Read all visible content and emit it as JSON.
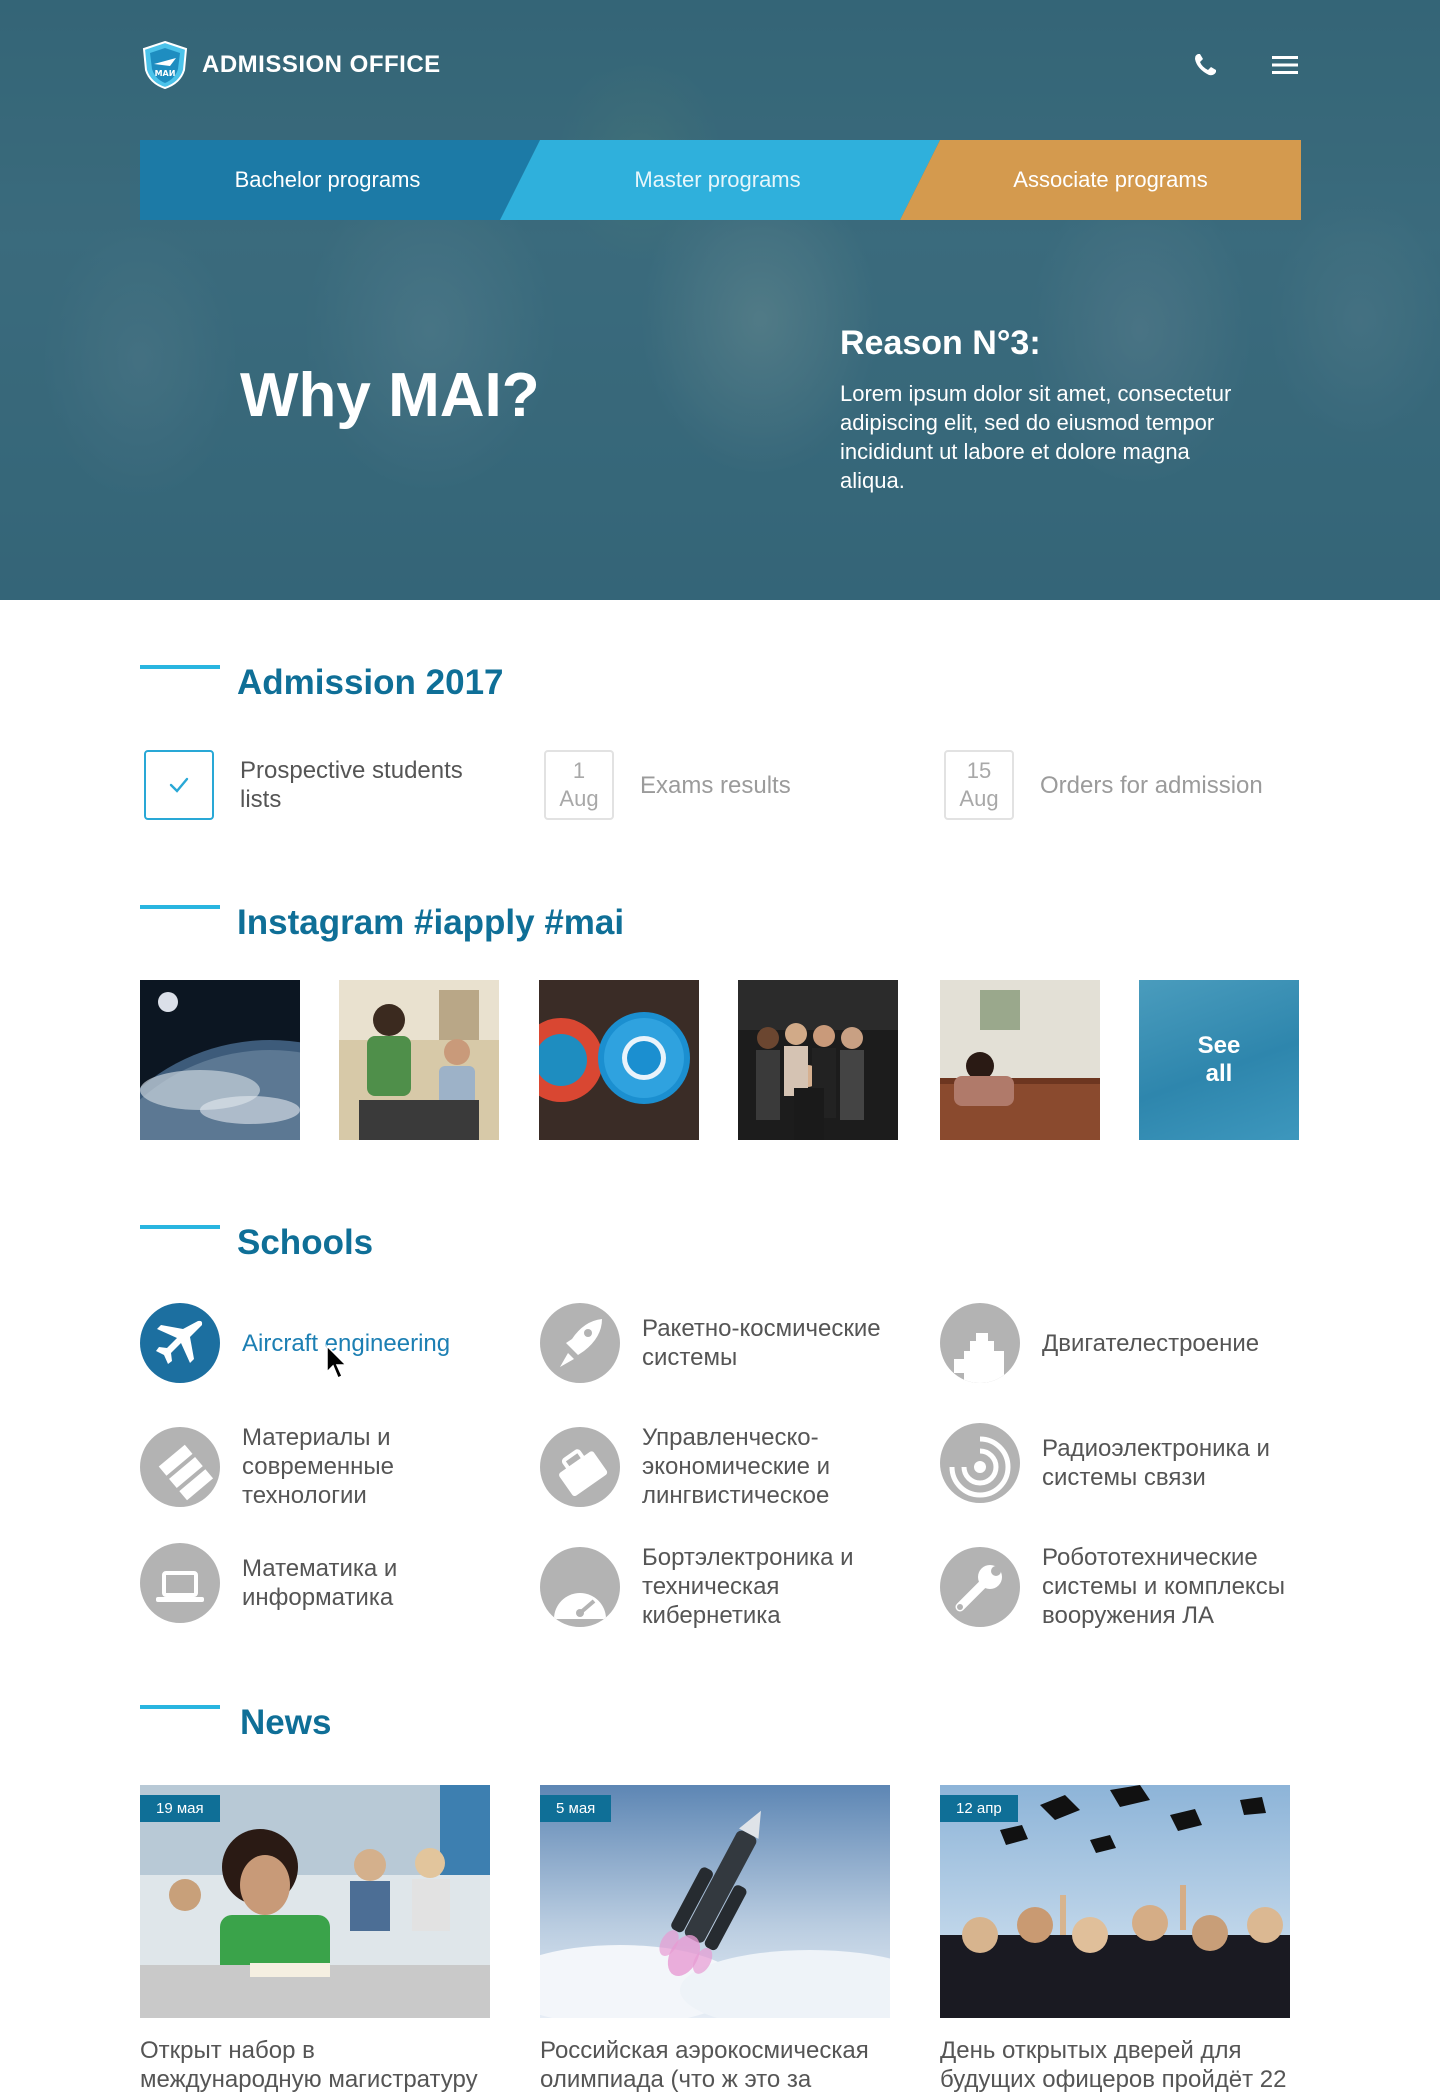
{
  "header": {
    "logo_text": "ADMISSION OFFICE",
    "logo_mark": "МАИ",
    "icons": [
      "phone-icon",
      "menu-icon"
    ]
  },
  "program_tabs": [
    {
      "label": "Bachelor programs",
      "color": "#1c7aa6"
    },
    {
      "label": "Master programs",
      "color": "#2fb0dc"
    },
    {
      "label": "Associate programs",
      "color": "#d49a4e"
    }
  ],
  "hero": {
    "headline": "Why MAI?",
    "reason_title": "Reason N°3:",
    "reason_text": "Lorem ipsum dolor sit amet, consectetur adipiscing elit, sed do eiusmod tempor incididunt ut labore et dolore magna aliqua."
  },
  "admission": {
    "heading": "Admission 2017",
    "items": [
      {
        "label": "Prospective students lists",
        "status": "done",
        "icon": "check-icon"
      },
      {
        "day": "1",
        "month": "Aug",
        "label": "Exams results"
      },
      {
        "day": "15",
        "month": "Aug",
        "label": "Orders for admission"
      }
    ]
  },
  "instagram": {
    "heading": "Instagram #iapply #mai",
    "see_all": "See all"
  },
  "schools": {
    "heading": "Schools",
    "items": [
      {
        "label": "Aircraft engineering",
        "icon": "airplane-icon",
        "active": true
      },
      {
        "label": "Ракетно-космические системы",
        "icon": "rocket-icon"
      },
      {
        "label": "Двигателестроение",
        "icon": "engine-icon"
      },
      {
        "label": "Материалы и современные технологии",
        "icon": "materials-icon"
      },
      {
        "label": "Управленческо-экономические и лингвистическое",
        "icon": "briefcase-icon"
      },
      {
        "label": "Радиоэлектроника и системы связи",
        "icon": "signal-icon"
      },
      {
        "label": "Математика и информатика",
        "icon": "laptop-icon"
      },
      {
        "label": "Бортэлектроника и техническая кибернетика",
        "icon": "gauge-icon"
      },
      {
        "label": "Робототехнические системы и комплексы вооружения ЛА",
        "icon": "wrench-icon"
      }
    ]
  },
  "news": {
    "heading": "News",
    "items": [
      {
        "date": "19 мая",
        "title": "Открыт набор в международную магистратуру"
      },
      {
        "date": "5 мая",
        "title": "Российская аэрокосмическая олимпиада (что ж это за"
      },
      {
        "date": "12 апр",
        "title": "День открытых дверей для будущих офицеров пройдёт 22"
      }
    ]
  }
}
